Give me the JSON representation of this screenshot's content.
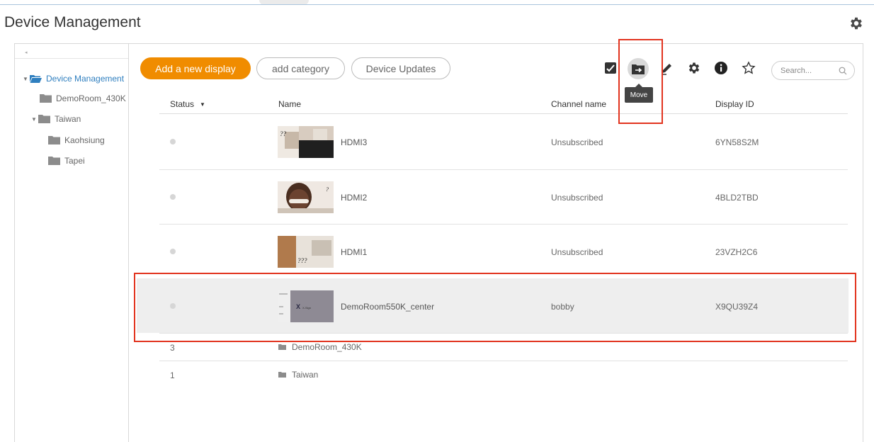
{
  "page": {
    "title": "Device Management"
  },
  "sidebar": {
    "tree": [
      {
        "label": "Device Management",
        "level": 0,
        "expanded": true,
        "active": true
      },
      {
        "label": "DemoRoom_430K",
        "level": 1
      },
      {
        "label": "Taiwan",
        "level": 1,
        "expanded": true
      },
      {
        "label": "Kaohsiung",
        "level": 2
      },
      {
        "label": "Tapei",
        "level": 2
      }
    ]
  },
  "toolbar": {
    "add_display": "Add a new display",
    "add_category": "add category",
    "device_updates": "Device Updates",
    "tooltip_move": "Move",
    "search_placeholder": "Search...",
    "icons": [
      "check-square-icon",
      "move-folder-icon",
      "edit-pencil-icon",
      "settings-gear-icon",
      "info-icon",
      "star-icon"
    ]
  },
  "table": {
    "headers": {
      "status": "Status",
      "name": "Name",
      "channel": "Channel name",
      "display_id": "Display ID"
    },
    "rows": [
      {
        "name": "HDMI3",
        "channel": "Unsubscribed",
        "display_id": "6YN58S2M"
      },
      {
        "name": "HDMI2",
        "channel": "Unsubscribed",
        "display_id": "4BLD2TBD"
      },
      {
        "name": "HDMI1",
        "channel": "Unsubscribed",
        "display_id": "23VZH2C6"
      },
      {
        "name": "DemoRoom550K_center",
        "channel": "bobby",
        "display_id": "X9QU39Z4",
        "selected": true
      }
    ],
    "folders": [
      {
        "count": "3",
        "name": "DemoRoom_430K"
      },
      {
        "count": "1",
        "name": "Taiwan"
      }
    ]
  },
  "colors": {
    "accent": "#f08c00",
    "highlight": "#e2341f",
    "link": "#2f7fbf"
  }
}
